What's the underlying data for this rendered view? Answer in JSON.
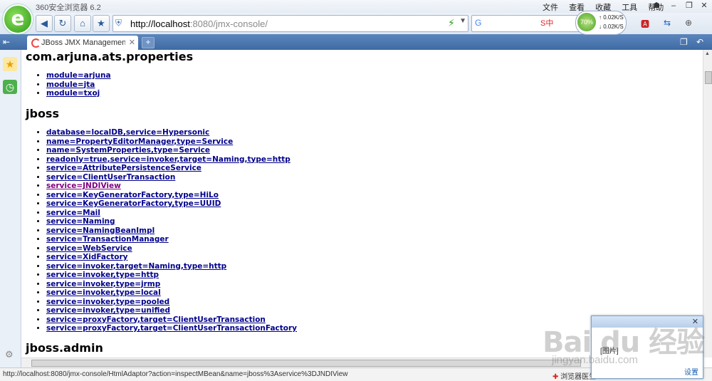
{
  "window": {
    "app_title": "360安全浏览器 6.2",
    "menu": [
      "文件",
      "查看",
      "收藏",
      "工具",
      "帮助"
    ]
  },
  "navbar": {
    "url_host": "http://localhost",
    "url_path": ":8080/jmx-console/",
    "speed_percent": "70%",
    "speed_up": "0.02K/S",
    "speed_down": "0.02K/S"
  },
  "tabs": [
    {
      "label": "JBoss JMX Management Co"
    }
  ],
  "content": {
    "sections": [
      {
        "title": "com.arjuna.ats.properties",
        "items": [
          {
            "label": "module=arjuna",
            "visited": false
          },
          {
            "label": "module=jta",
            "visited": false
          },
          {
            "label": "module=txoj",
            "visited": false
          }
        ]
      },
      {
        "title": "jboss",
        "items": [
          {
            "label": "database=localDB,service=Hypersonic",
            "visited": false
          },
          {
            "label": "name=PropertyEditorManager,type=Service",
            "visited": false
          },
          {
            "label": "name=SystemProperties,type=Service",
            "visited": false
          },
          {
            "label": "readonly=true,service=invoker,target=Naming,type=http",
            "visited": false
          },
          {
            "label": "service=AttributePersistenceService",
            "visited": false
          },
          {
            "label": "service=ClientUserTransaction",
            "visited": false
          },
          {
            "label": "service=JNDIView",
            "visited": true
          },
          {
            "label": "service=KeyGeneratorFactory,type=HiLo",
            "visited": false
          },
          {
            "label": "service=KeyGeneratorFactory,type=UUID",
            "visited": false
          },
          {
            "label": "service=Mail",
            "visited": false
          },
          {
            "label": "service=Naming",
            "visited": false
          },
          {
            "label": "service=NamingBeanImpl",
            "visited": false
          },
          {
            "label": "service=TransactionManager",
            "visited": false
          },
          {
            "label": "service=WebService",
            "visited": false
          },
          {
            "label": "service=XidFactory",
            "visited": false
          },
          {
            "label": "service=invoker,target=Naming,type=http",
            "visited": false
          },
          {
            "label": "service=invoker,type=http",
            "visited": false
          },
          {
            "label": "service=invoker,type=jrmp",
            "visited": false
          },
          {
            "label": "service=invoker,type=local",
            "visited": false
          },
          {
            "label": "service=invoker,type=pooled",
            "visited": false
          },
          {
            "label": "service=invoker,type=unified",
            "visited": false
          },
          {
            "label": "service=proxyFactory,target=ClientUserTransaction",
            "visited": false
          },
          {
            "label": "service=proxyFactory,target=ClientUserTransactionFactory",
            "visited": false
          }
        ]
      },
      {
        "title": "jboss.admin",
        "items": []
      }
    ]
  },
  "statusbar": {
    "url": "http://localhost:8080/jmx-console/HtmlAdaptor?action=inspectMBean&name=jboss%3Aservice%3DJNDIView",
    "doctor": "浏览器医生"
  },
  "popup": {
    "image_label": "[图片]",
    "settings": "设置"
  },
  "watermark": {
    "logo": "Bai du 经验",
    "sub": "jingyan.baidu.com"
  },
  "icons": {
    "back": "back-arrow-icon",
    "forward": "forward-arrow-icon",
    "refresh": "refresh-icon",
    "home": "home-icon",
    "favorite": "star-icon",
    "security": "shield-icon"
  },
  "colors": {
    "link": "#00008b",
    "visited_link": "#800080",
    "tabbar": "#4a76b0"
  }
}
